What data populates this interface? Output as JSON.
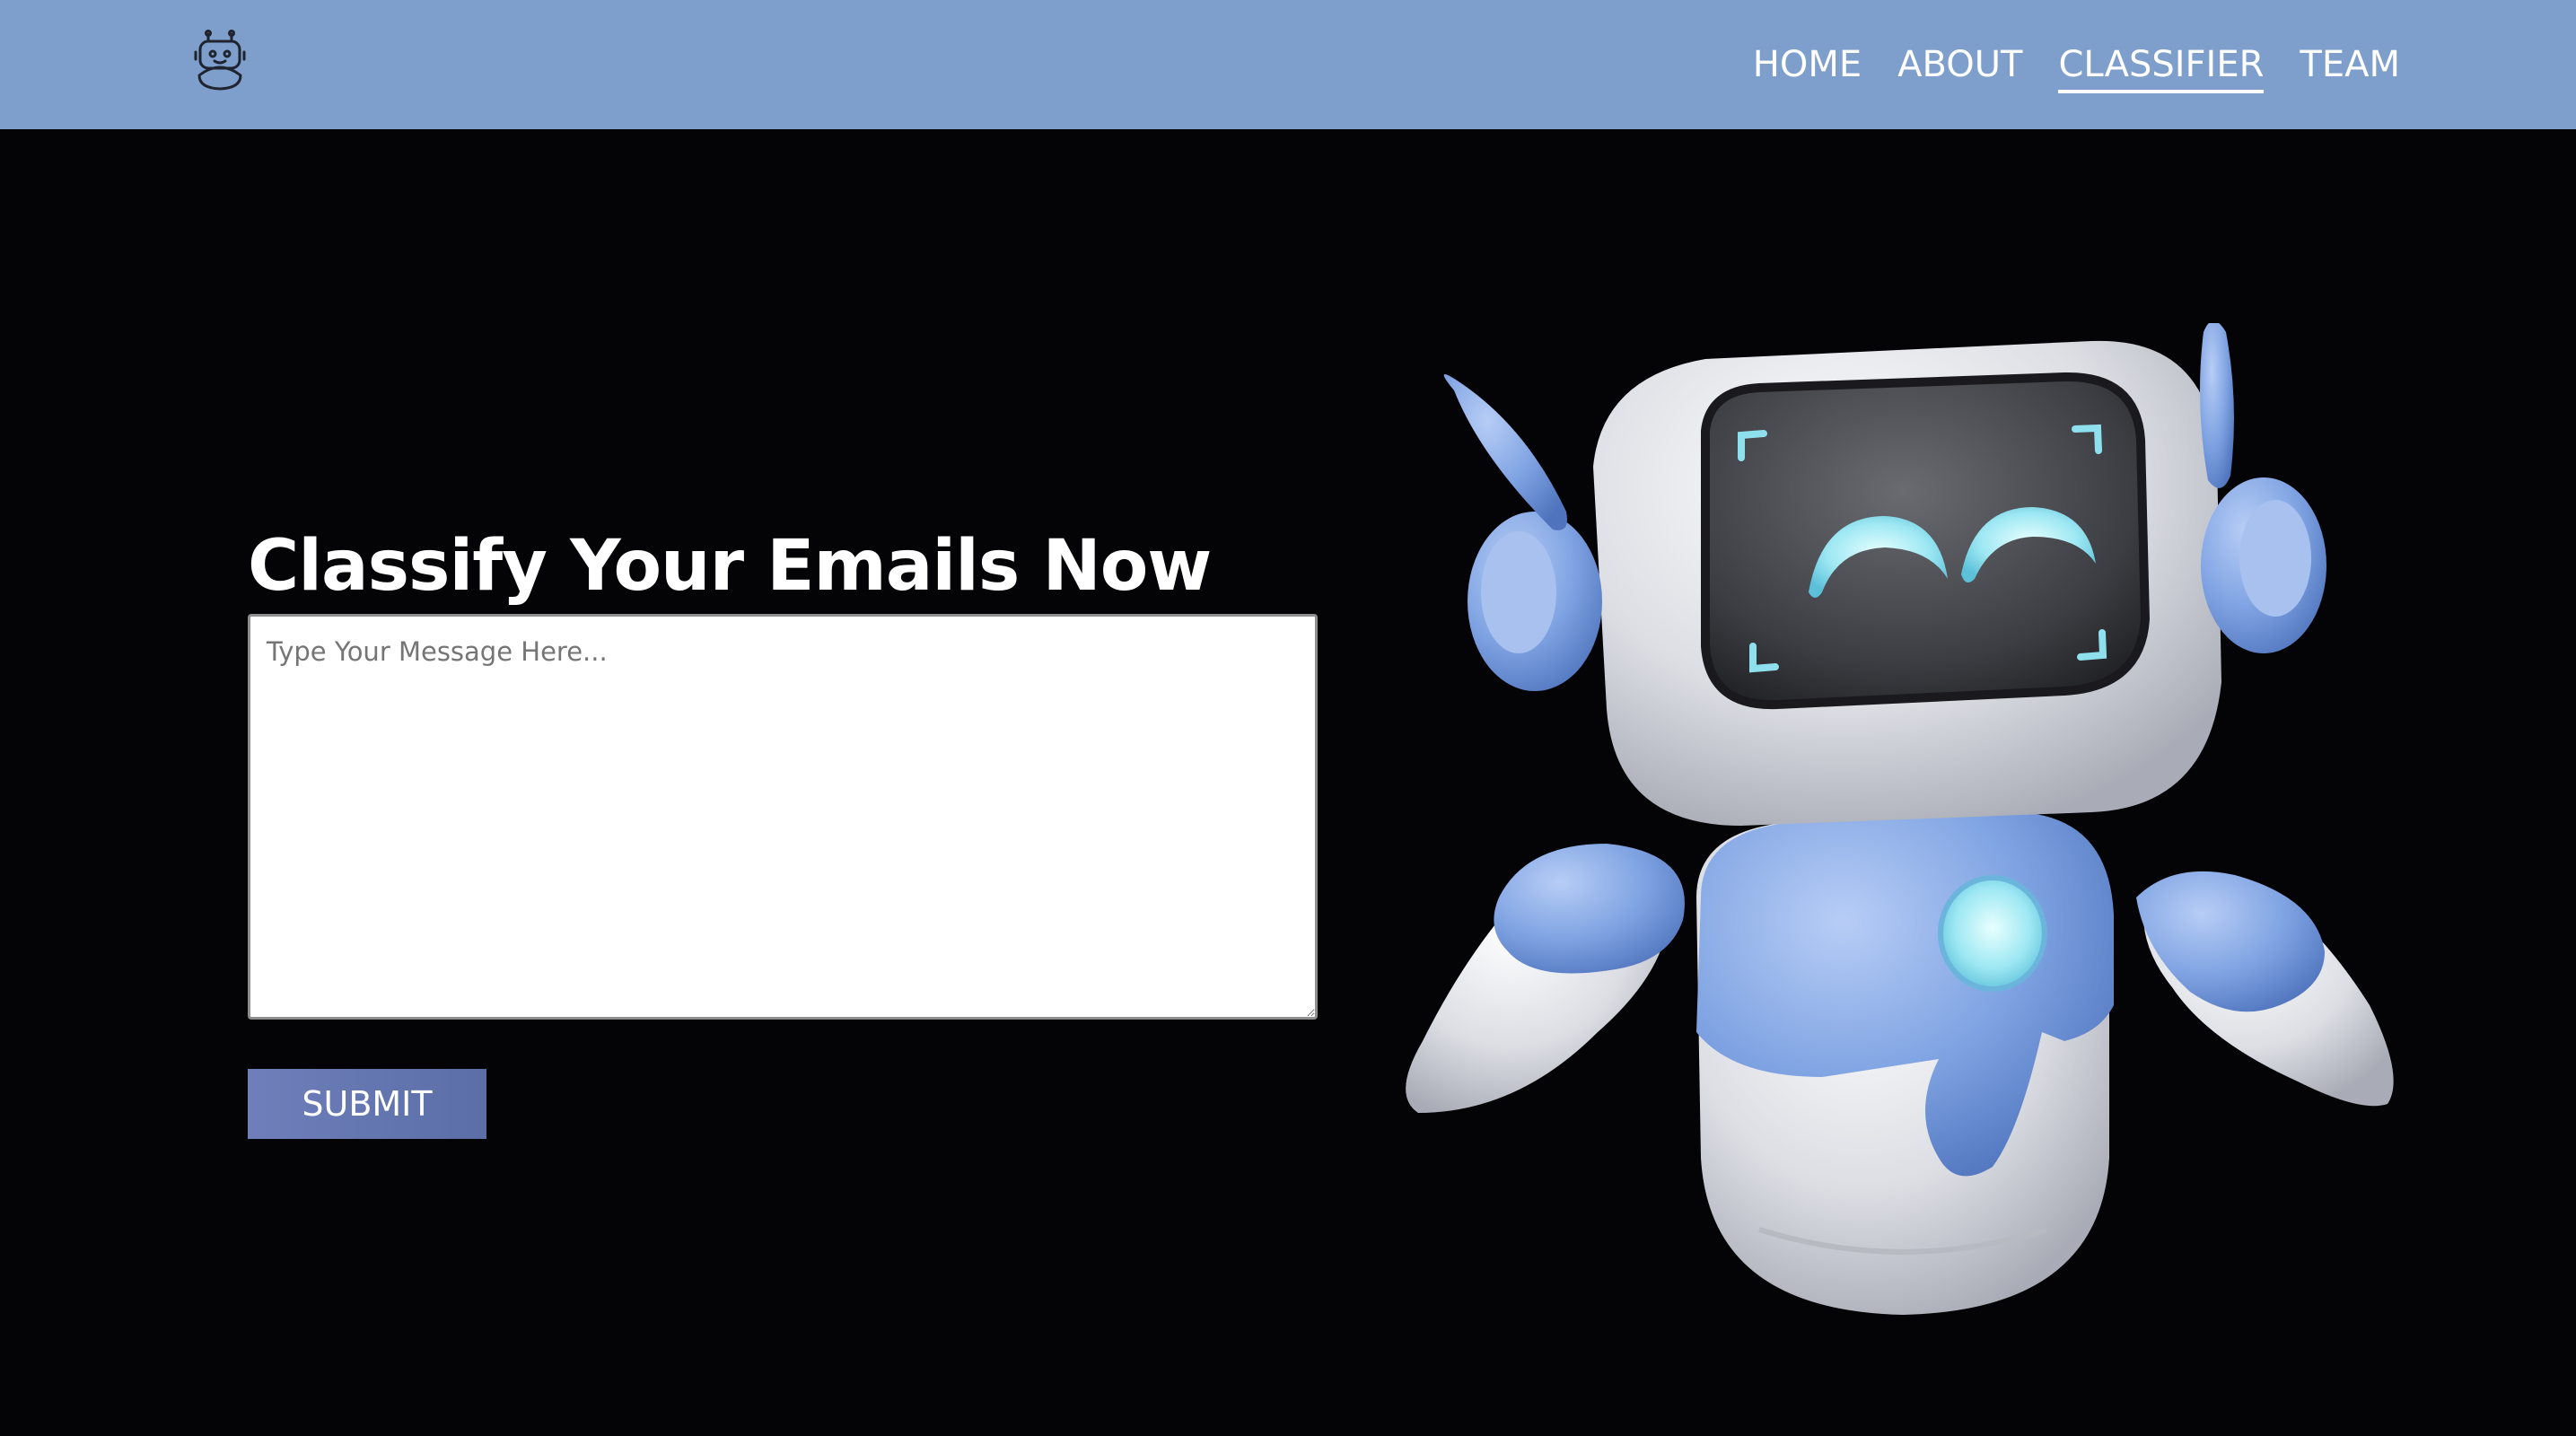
{
  "nav": {
    "links": [
      {
        "label": "HOME",
        "active": false
      },
      {
        "label": "ABOUT",
        "active": false
      },
      {
        "label": "CLASSIFIER",
        "active": true
      },
      {
        "label": "TEAM",
        "active": false
      }
    ]
  },
  "logo": {
    "icon": "robot-logo-icon"
  },
  "main": {
    "headline": "Classify Your Emails Now",
    "message_placeholder": "Type Your Message Here...",
    "submit_label": "SUBMIT"
  },
  "hero": {
    "icon": "robot-illustration"
  },
  "colors": {
    "navbar": "#7e9fcb",
    "background": "#040407",
    "button": "#6477b2",
    "robot_accent": "#7fa3e2"
  }
}
